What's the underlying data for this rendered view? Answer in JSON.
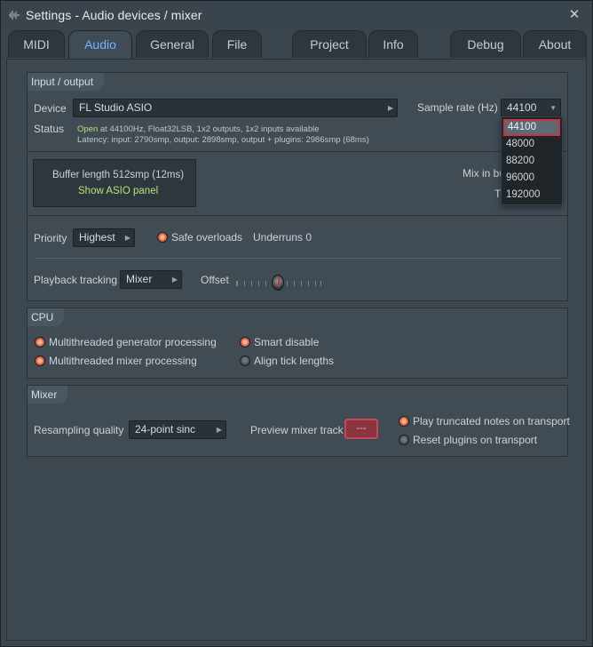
{
  "window": {
    "title": "Settings - Audio devices / mixer",
    "close": "✕"
  },
  "tabs": [
    {
      "label": "MIDI"
    },
    {
      "label": "Audio"
    },
    {
      "label": "General"
    },
    {
      "label": "File"
    },
    {
      "label": "Project"
    },
    {
      "label": "Info"
    },
    {
      "label": "Debug"
    },
    {
      "label": "About"
    }
  ],
  "active_tab": "Audio",
  "io": {
    "title": "Input / output",
    "device_label": "Device",
    "device_value": "FL Studio ASIO",
    "sample_rate_label": "Sample rate (Hz)",
    "sample_rate_value": "44100",
    "status_label": "Status",
    "status_open": "Open",
    "status_line1": " at 44100Hz, Float32LSB, 1x2 outputs, 1x2 inputs available",
    "status_line2": "Latency: input: 2790smp, output: 2898smp, output + plugins: 2986smp (68ms)",
    "buffer_label": "Buffer length 512smp (12ms)",
    "asio_link": "Show ASIO panel",
    "mix_in_label": "Mix in bu",
    "t_label": "T",
    "priority_label": "Priority",
    "priority_value": "Highest",
    "safe_overloads_label": "Safe overloads",
    "underruns_label": "Underruns 0",
    "playback_tracking_label": "Playback tracking",
    "playback_tracking_value": "Mixer",
    "offset_label": "Offset"
  },
  "sample_rate_options": [
    "44100",
    "48000",
    "88200",
    "96000",
    "192000"
  ],
  "sample_rate_selected": "44100",
  "cpu": {
    "title": "CPU",
    "options": [
      {
        "label": "Multithreaded generator processing",
        "checked": true
      },
      {
        "label": "Multithreaded mixer processing",
        "checked": true
      },
      {
        "label": "Smart disable",
        "checked": true
      },
      {
        "label": "Align tick lengths",
        "checked": false
      }
    ]
  },
  "mixer": {
    "title": "Mixer",
    "resampling_label": "Resampling quality",
    "resampling_value": "24-point sinc",
    "preview_label": "Preview mixer track",
    "preview_value": "---",
    "options": [
      {
        "label": "Play truncated notes on transport",
        "checked": true
      },
      {
        "label": "Reset plugins on transport",
        "checked": false
      }
    ]
  },
  "colors": {
    "accent_tab": "#71b8ff",
    "radio_on": "#f07a55",
    "status_open": "#b8e07a",
    "preview_button": "#8a3440",
    "dropdown_selected_border": "#c83340"
  }
}
